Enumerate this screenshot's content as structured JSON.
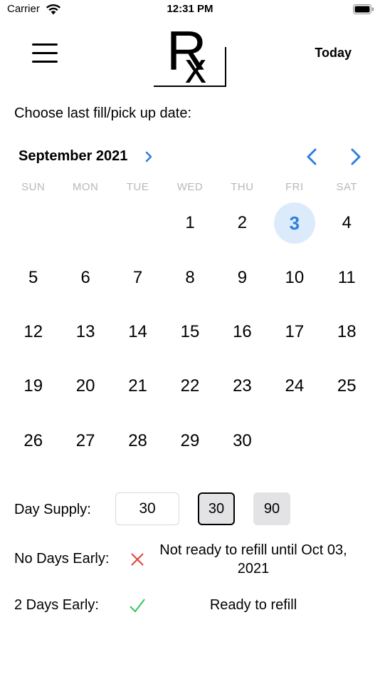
{
  "status_bar": {
    "carrier": "Carrier",
    "time": "12:31 PM",
    "wifi_icon": "wifi-icon",
    "battery_icon": "battery-icon"
  },
  "header": {
    "menu_icon": "hamburger-menu-icon",
    "logo_text": "Rx",
    "today_label": "Today"
  },
  "prompt": "Choose last fill/pick up date:",
  "calendar": {
    "month_label": "September 2021",
    "selected_day": "3",
    "accent_color": "#2d7fe0",
    "selected_bg_color": "#dcebfb",
    "weekdays": [
      "SUN",
      "MON",
      "TUE",
      "WED",
      "THU",
      "FRI",
      "SAT"
    ],
    "days": [
      "",
      "",
      "",
      "1",
      "2",
      "3",
      "4",
      "5",
      "6",
      "7",
      "8",
      "9",
      "10",
      "11",
      "12",
      "13",
      "14",
      "15",
      "16",
      "17",
      "18",
      "19",
      "20",
      "21",
      "22",
      "23",
      "24",
      "25",
      "26",
      "27",
      "28",
      "29",
      "30",
      "",
      ""
    ]
  },
  "supply": {
    "label": "Day Supply:",
    "input_value": "30",
    "option_30": "30",
    "option_90": "90"
  },
  "no_days_early": {
    "label": "No Days Early:",
    "status": "Not ready to refill until  Oct 03, 2021",
    "icon": "x-mark-icon",
    "icon_color": "#e0443a"
  },
  "two_days_early": {
    "label": "2 Days Early:",
    "status": "Ready to refill",
    "icon": "check-mark-icon",
    "icon_color": "#35c759"
  }
}
